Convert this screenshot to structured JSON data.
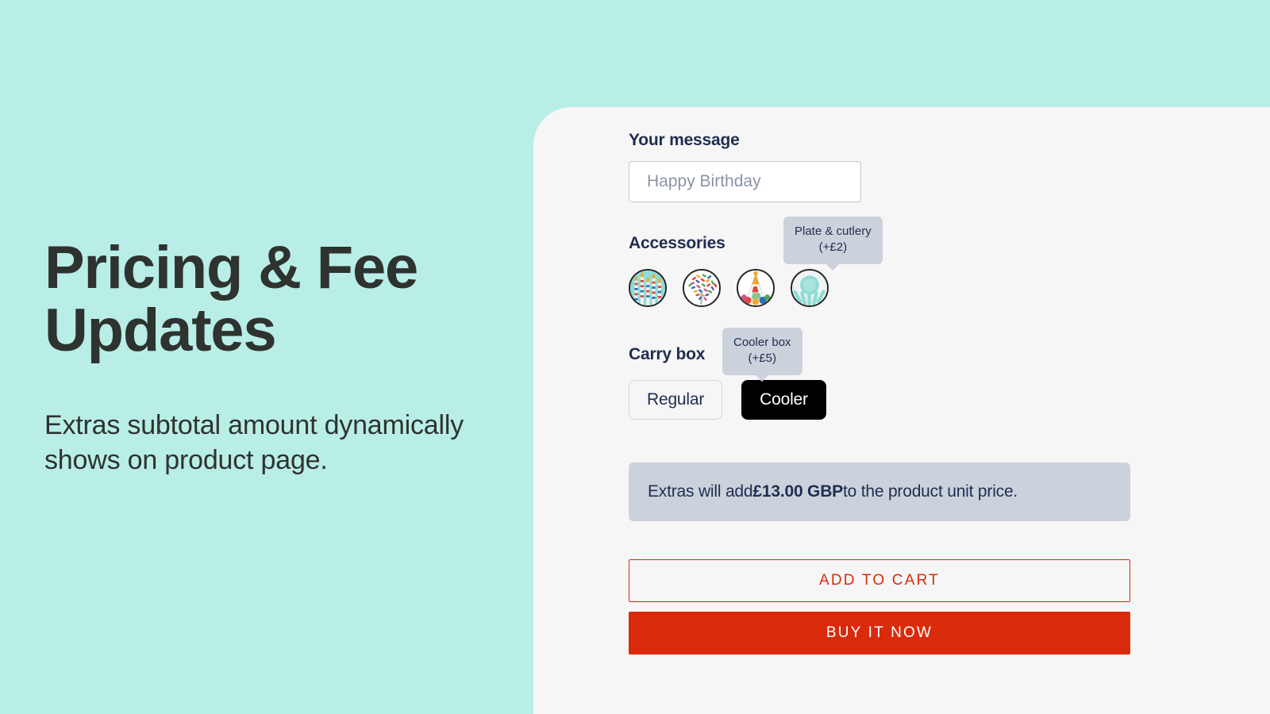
{
  "promo": {
    "title": "Pricing & Fee Updates",
    "subtitle": "Extras subtotal amount dynamically shows on product page."
  },
  "colors": {
    "page_background": "#b9eee6",
    "panel_background": "#f6f6f6",
    "label_navy": "#1f2d50",
    "tooltip_background": "#ccd2dc",
    "accent_red": "#d92b0c",
    "selected_swatch_black": "#000000"
  },
  "form": {
    "message": {
      "label": "Your message",
      "value": "",
      "placeholder": "Happy Birthday"
    },
    "accessories": {
      "label": "Accessories",
      "tooltip": {
        "name": "Plate & cutlery",
        "price": "(+£2)"
      },
      "options": [
        {
          "icon": "birthday-candles-icon",
          "name": "Candles",
          "selected": false
        },
        {
          "icon": "sprinkles-icon",
          "name": "Sprinkles",
          "selected": false
        },
        {
          "icon": "party-hat-icon",
          "name": "Party hat",
          "selected": false
        },
        {
          "icon": "plate-cutlery-icon",
          "name": "Plate & cutlery",
          "selected": true
        }
      ]
    },
    "carry_box": {
      "label": "Carry box",
      "tooltip": {
        "name": "Cooler box",
        "price": "(+£5)"
      },
      "options": [
        {
          "label": "Regular",
          "selected": false
        },
        {
          "label": "Cooler",
          "selected": true
        }
      ]
    },
    "extras_banner": {
      "prefix": "Extras will add ",
      "amount": "£13.00 GBP",
      "suffix": " to the product unit price."
    },
    "actions": {
      "add_to_cart": "ADD TO CART",
      "buy_it_now": "BUY IT NOW"
    }
  }
}
